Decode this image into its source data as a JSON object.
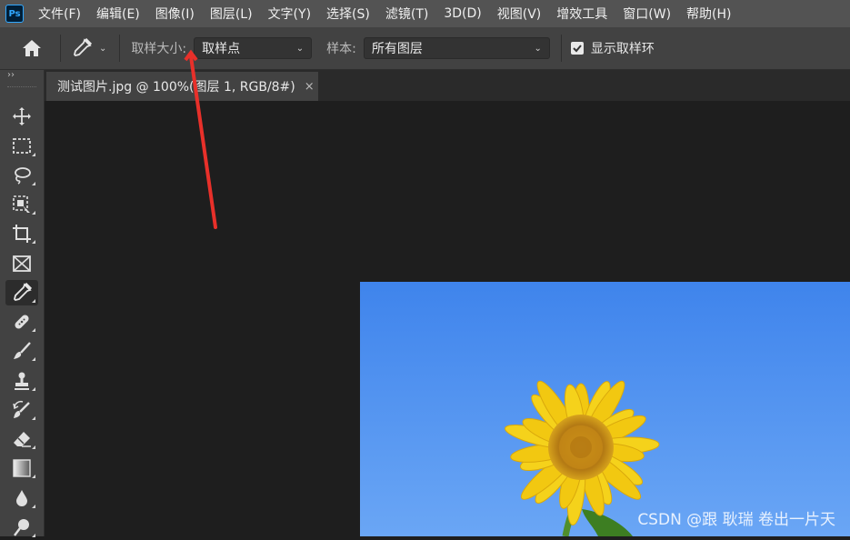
{
  "app": {
    "logo_text": "Ps"
  },
  "menu": [
    "文件(F)",
    "编辑(E)",
    "图像(I)",
    "图层(L)",
    "文字(Y)",
    "选择(S)",
    "滤镜(T)",
    "3D(D)",
    "视图(V)",
    "增效工具",
    "窗口(W)",
    "帮助(H)"
  ],
  "options": {
    "sample_size_label": "取样大小:",
    "sample_size_value": "取样点",
    "sample_label": "样本:",
    "sample_value": "所有图层",
    "show_ring_label": "显示取样环",
    "show_ring_checked": true
  },
  "toolbar": {
    "collapse_glyph": "››",
    "tools": [
      "move-tool",
      "marquee-tool",
      "lasso-tool",
      "object-selection-tool",
      "crop-tool",
      "frame-tool",
      "eyedropper-tool",
      "healing-brush-tool",
      "brush-tool",
      "clone-stamp-tool",
      "history-brush-tool",
      "eraser-tool",
      "gradient-tool",
      "blur-tool",
      "dodge-tool"
    ],
    "active_tool": "eyedropper-tool"
  },
  "document": {
    "tab_title": "测试图片.jpg @ 100%(图层 1, RGB/8#)",
    "close_glyph": "×"
  },
  "watermark": "CSDN @跟 耿瑞 卷出一片天",
  "colors": {
    "accent_arrow": "#e8302a",
    "sky": "#4f8ff0",
    "petal": "#f2c811"
  }
}
